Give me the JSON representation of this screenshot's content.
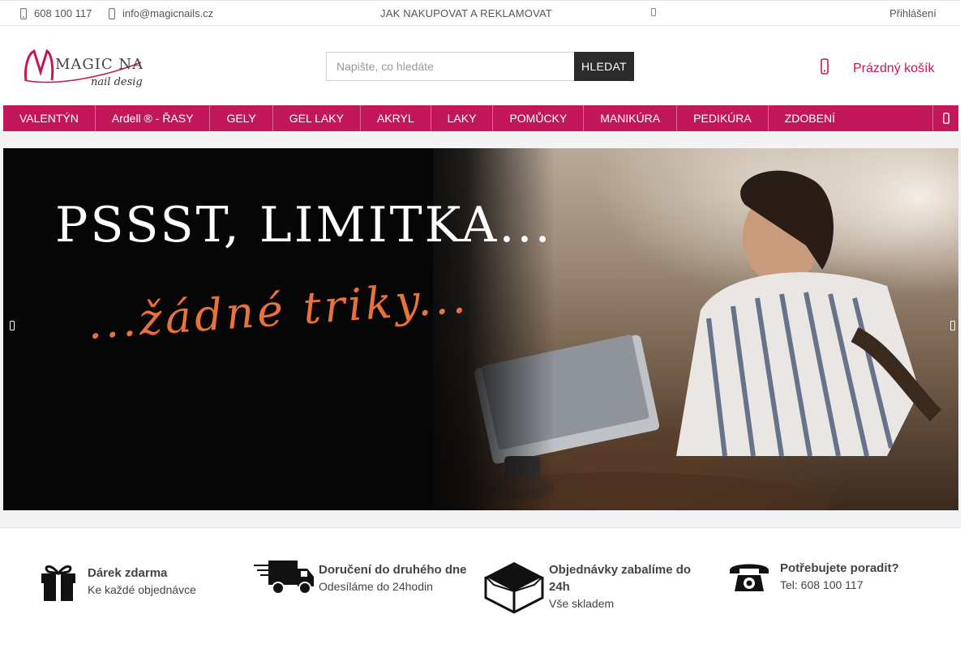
{
  "topbar": {
    "phone": "608 100 117",
    "email": "info@magicnails.cz",
    "howto": "JAK NAKUPOVAT A REKLAMOVAT",
    "login": "Přihlášení",
    "icons": [
      "phone-icon",
      "envelope-icon",
      "globe-icon"
    ]
  },
  "header": {
    "logo_text": "MAGIC NAILS",
    "logo_sub": "nail design",
    "search": {
      "placeholder": "Napište, co hledáte",
      "button": "HLEDAT"
    },
    "cart": {
      "label": "Prázdný košík",
      "icon": "cart-icon"
    }
  },
  "nav": {
    "items": [
      "VALENTÝN",
      "Ardell ® - ŘASY",
      "GELY",
      "GEL LAKY",
      "AKRYL",
      "LAKY",
      "POMŮCKY",
      "MANIKÚRA",
      "PEDIKÚRA",
      "ZDOBENÍ"
    ],
    "more_icon": "menu-icon"
  },
  "banner": {
    "headline": "PSSST, LIMITKA...",
    "script": "...žádné triky...",
    "icons": [
      "chevron-left-icon",
      "chevron-right-icon"
    ]
  },
  "benefits": [
    {
      "title": "Dárek zdarma",
      "subtitle": "Ke každé objednávce",
      "icon": "gift-icon"
    },
    {
      "title": "Doručení do druhého dne",
      "subtitle": "Odesíláme do 24hodin",
      "icon": "truck-icon"
    },
    {
      "title": "Objednávky zabalíme do 24h",
      "subtitle": "Vše skladem",
      "icon": "box-icon"
    },
    {
      "title": "Potřebujete poradit?",
      "subtitle": "Tel: 608 100 117",
      "icon": "telephone-icon"
    }
  ],
  "colors": {
    "brand": "#c2185b",
    "dark": "#2b2b2b",
    "accent_orange": "#e8733a"
  }
}
